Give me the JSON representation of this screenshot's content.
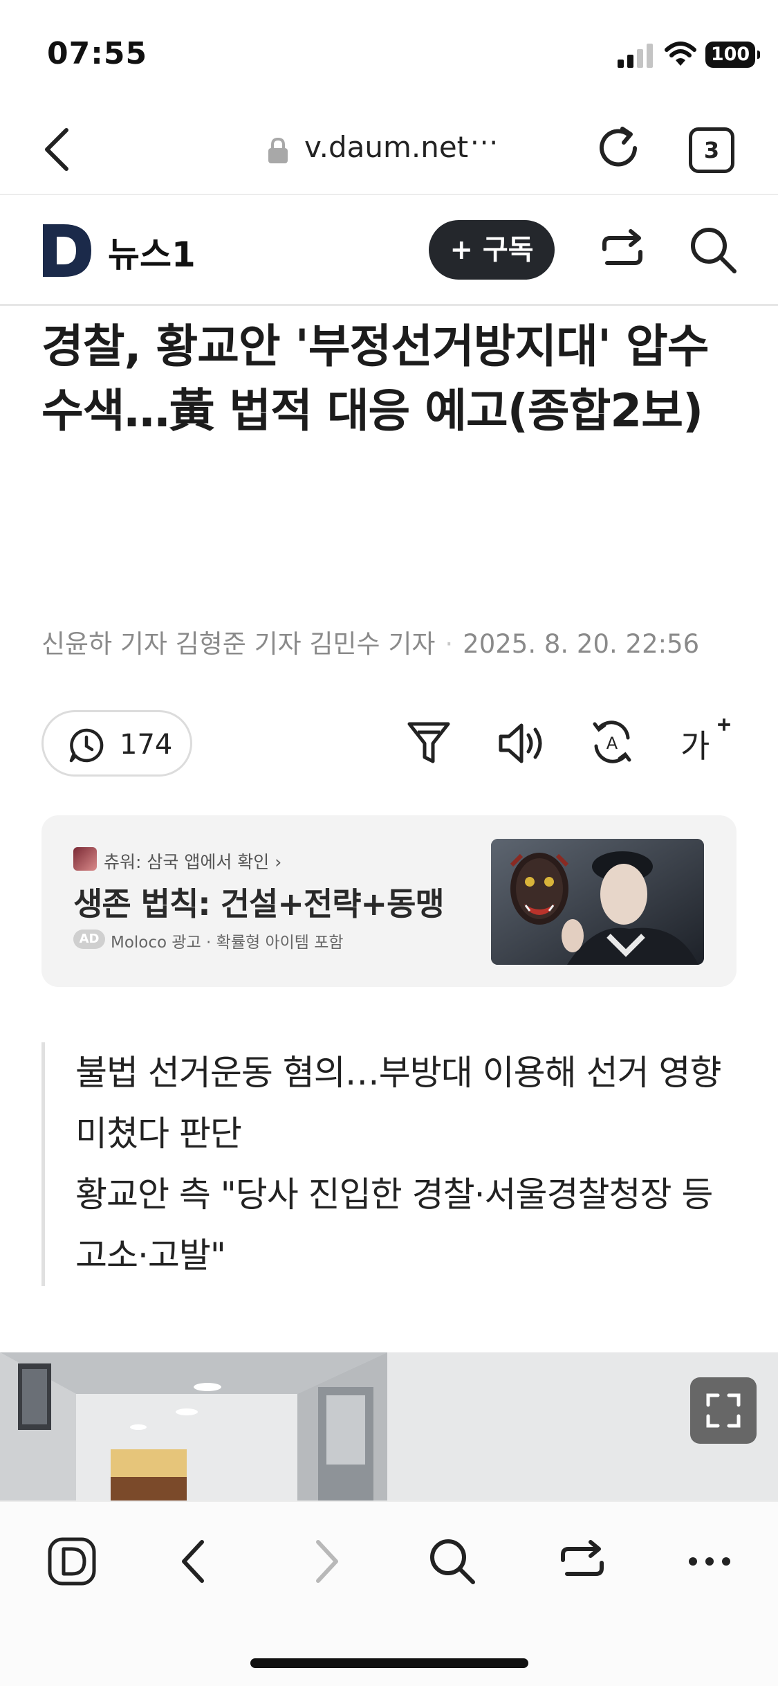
{
  "status_bar": {
    "time": "07:55",
    "battery": "100"
  },
  "browser": {
    "url": "v.daum.net",
    "url_more": "···",
    "tab_count": "3"
  },
  "site": {
    "brand": "뉴스1",
    "subscribe_label": "+ 구독"
  },
  "article": {
    "headline": "경찰, 황교안 '부정선거방지대' 압수수색…黃 법적 대응 예고(종합2보)",
    "byline": "신윤하 기자 김형준 기자 김민수 기자",
    "date": "2025. 8. 20. 22:56",
    "comment_count": "174",
    "font_size_tool": "가",
    "summary": [
      "불법 선거운동 혐의…부방대 이용해 선거 영향 미쳤다 판단",
      "황교안 측 \"당사 진입한 경찰·서울경찰청장 등 고소·고발\""
    ]
  },
  "ad": {
    "app_line": "츄워: 삼국 앱에서 확인 ›",
    "title": "생존 법칙: 건설+전략+동맹",
    "badge": "AD",
    "meta": "Moloco 광고 · 확률형 아이템 포함"
  },
  "icons": {
    "back": "chevron-left-icon",
    "lock": "lock-icon",
    "reload": "reload-icon",
    "share": "share-icon",
    "search": "search-icon",
    "comment": "comment-icon",
    "filter": "filter-icon",
    "audio": "speaker-icon",
    "translate": "translate-icon",
    "expand": "expand-icon"
  },
  "colors": {
    "brand_navy": "#1b2a4a",
    "subscribe_bg": "#24272c",
    "byline": "#8a8a8a"
  }
}
